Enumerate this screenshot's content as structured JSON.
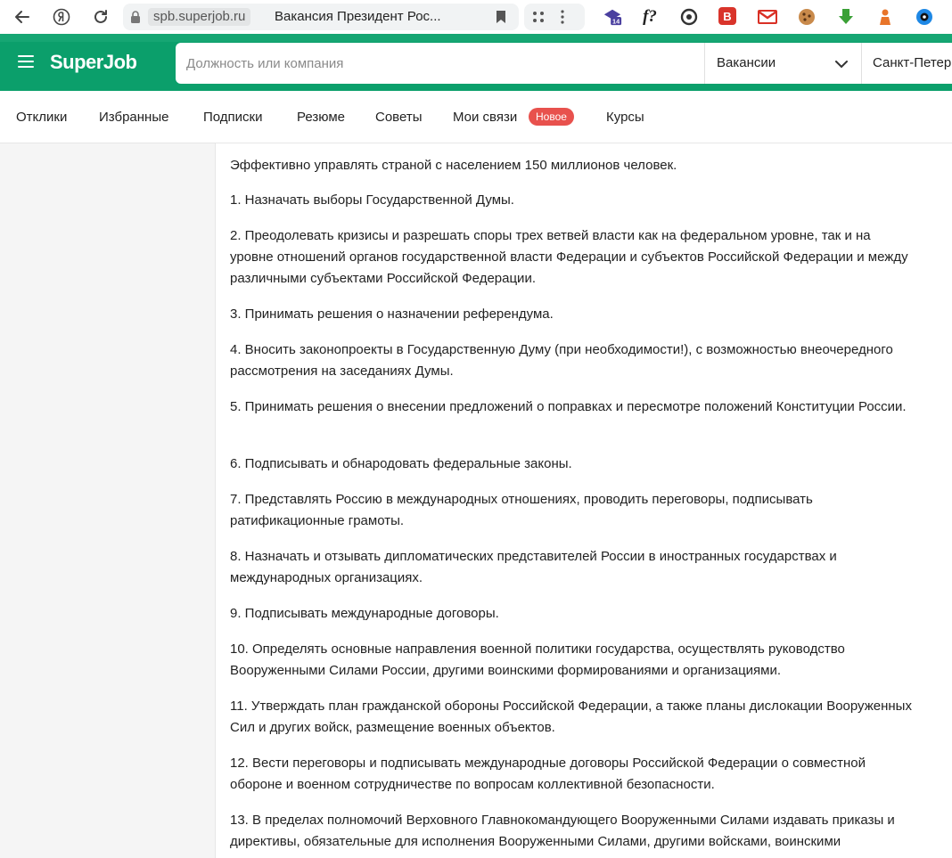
{
  "browser": {
    "domain": "spb.superjob.ru",
    "tab_title": "Вакансия Президент Рос...",
    "extensions": [
      {
        "name": "calendar-14-extension",
        "label": "14",
        "color": "#4a3f9f"
      },
      {
        "name": "f-question-extension",
        "label": "f?",
        "color": "#222222"
      },
      {
        "name": "refresh-circle-extension",
        "label": "",
        "color": "#333333"
      },
      {
        "name": "b-red-extension",
        "label": "B",
        "color": "#d9342b"
      },
      {
        "name": "gmail-extension",
        "label": "M",
        "color": "#d93025"
      },
      {
        "name": "cookie-extension",
        "label": "",
        "color": "#a0522d"
      },
      {
        "name": "green-download-extension",
        "label": "",
        "color": "#3aa036"
      },
      {
        "name": "orange-figure-extension",
        "label": "",
        "color": "#e8752a"
      },
      {
        "name": "blue-circle-extension",
        "label": "",
        "color": "#1e88e5"
      }
    ]
  },
  "header": {
    "logo": "SuperJob",
    "search_placeholder": "Должность или компания",
    "type_select": "Вакансии",
    "city": "Санкт-Петер",
    "brand_color": "#0b9f6b"
  },
  "nav": {
    "items": [
      "Отклики",
      "Избранные",
      "Подписки",
      "Резюме",
      "Советы",
      "Мои связи",
      "Курсы"
    ],
    "badge": "Новое"
  },
  "content": {
    "paragraphs": [
      "Эффективно управлять страной с населением 150 миллионов человек.",
      "1. Назначать выборы Государственной Думы.",
      "2. Преодолевать кризисы и разрешать споры трех ветвей власти как на федеральном уровне, так и на уровне отношений органов государственной власти Федерации и субъектов Российской Федерации и между различными субъектами Российской Федерации.",
      "3. Принимать решения о назначении референдума.",
      "4. Вносить законопроекты в Государственную Думу (при необходимости!), с возможностью внеочередного рассмотрения на заседаниях Думы.",
      "5. Принимать решения о внесении предложений о поправках и пересмотре положений Конституции России.",
      "6. Подписывать и обнародовать федеральные законы.",
      "7. Представлять Россию в международных отношениях, проводить переговоры, подписывать ратификационные грамоты.",
      "8. Назначать и отзывать дипломатических представителей России в иностранных государствах и международных организациях.",
      "9. Подписывать международные договоры.",
      "10. Определять основные направления военной политики государства, осуществлять руководство Вооруженными Силами России, другими воинскими формированиями и организациями.",
      "11. Утверждать план гражданской обороны Российской Федерации, а также планы дислокации Вооруженных Сил и других войск, размещение военных объектов.",
      "12. Вести переговоры и подписывать международные договоры Российской Федерации о совместной обороне и военном сотрудничестве по вопросам коллективной безопасности.",
      "13. В пределах полномочий Верховного Главнокомандующего Вооруженными Силами издавать приказы и директивы, обязательные для исполнения Вооруженными Силами, другими войсками, воинскими"
    ]
  }
}
